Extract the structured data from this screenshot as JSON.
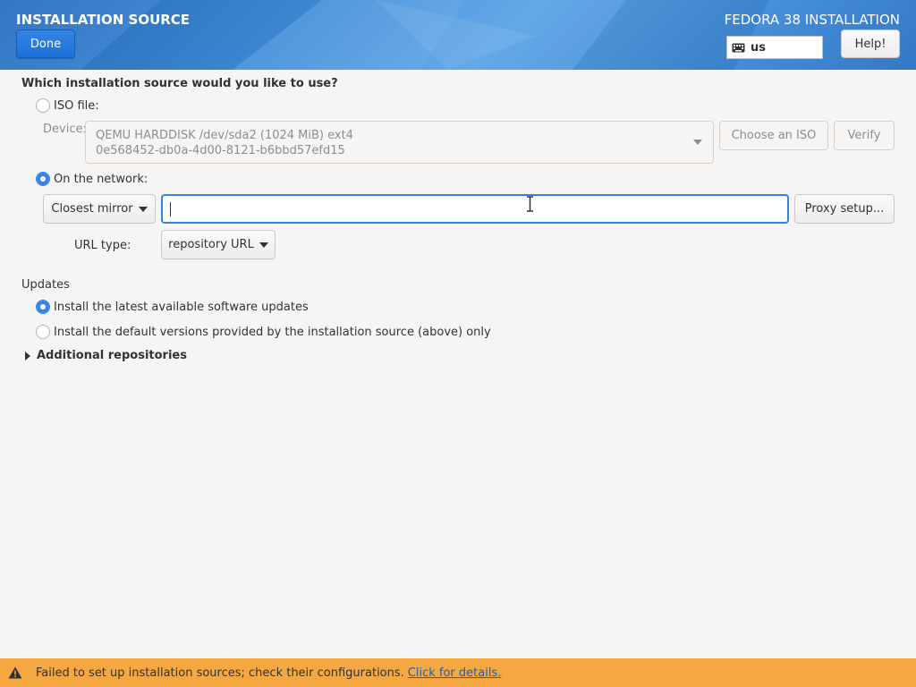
{
  "header": {
    "title": "INSTALLATION SOURCE",
    "product": "FEDORA 38 INSTALLATION",
    "done_label": "Done",
    "help_label": "Help!",
    "keyboard_layout": "us"
  },
  "source": {
    "question": "Which installation source would you like to use?",
    "iso_label": "ISO file:",
    "iso_selected": false,
    "device_label": "Device:",
    "device_line1": "QEMU HARDDISK /dev/sda2 (1024 MiB) ext4",
    "device_line2": "0e568452-db0a-4d00-8121-b6bbd57efd15",
    "choose_iso_label": "Choose an ISO",
    "verify_label": "Verify",
    "network_label": "On the network:",
    "network_selected": true,
    "mirror_option": "Closest mirror",
    "url_value": "",
    "proxy_label": "Proxy setup...",
    "url_type_label": "URL type:",
    "url_type_value": "repository URL"
  },
  "updates": {
    "heading": "Updates",
    "latest_label": "Install the latest available software updates",
    "latest_selected": true,
    "default_label": "Install the default versions provided by the installation source (above) only",
    "default_selected": false
  },
  "additional_repos_label": "Additional repositories",
  "warning": {
    "message": "Failed to set up installation sources; check their configurations.",
    "link": "Click for details."
  },
  "colors": {
    "accent": "#3584e4",
    "warning_bg": "#f5a742",
    "header_blue": "#3d8ad8"
  }
}
